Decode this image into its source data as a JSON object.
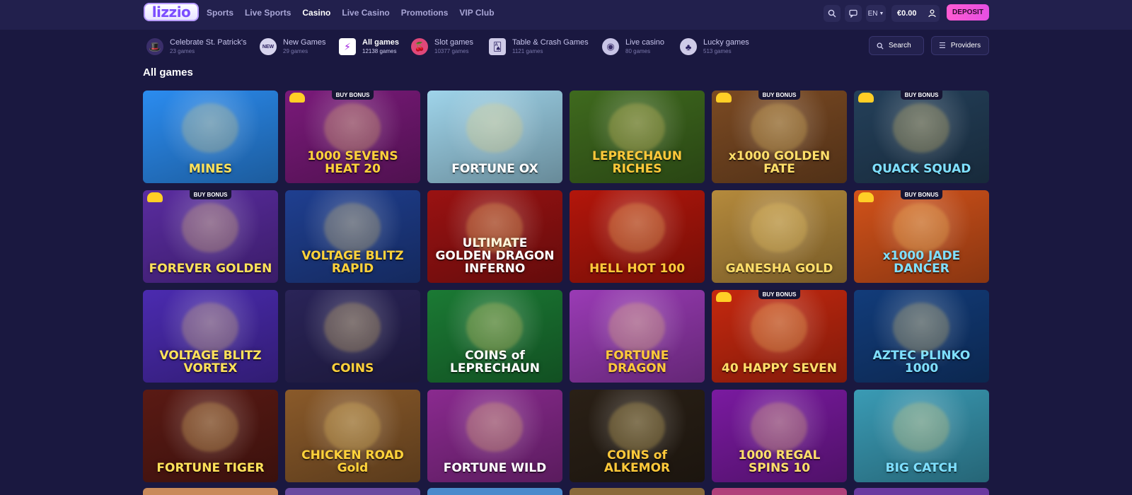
{
  "brand": {
    "logo": "lizzio"
  },
  "nav": {
    "items": [
      {
        "label": "Sports",
        "active": false
      },
      {
        "label": "Live Sports",
        "active": false
      },
      {
        "label": "Casino",
        "active": true
      },
      {
        "label": "Live Casino",
        "active": false
      },
      {
        "label": "Promotions",
        "active": false
      },
      {
        "label": "VIP Club",
        "active": false
      }
    ]
  },
  "topbar": {
    "search_icon": "search-icon",
    "chat_icon": "chat-icon",
    "language": "EN",
    "balance": "€0.00",
    "user_icon": "user-icon",
    "deposit_label": "DEPOSIT",
    "accent": "#ff5bd2"
  },
  "categories": [
    {
      "name": "Celebrate St. Patrick's",
      "count": "23 games",
      "icon": "hat-icon",
      "active": false
    },
    {
      "name": "New Games",
      "count": "29 games",
      "icon": "new-icon",
      "active": false
    },
    {
      "name": "All games",
      "count": "12138 games",
      "icon": "all-games-icon",
      "active": true
    },
    {
      "name": "Slot games",
      "count": "10377 games",
      "icon": "slot-icon",
      "active": false
    },
    {
      "name": "Table & Crash Games",
      "count": "1121 games",
      "icon": "cards-icon",
      "active": false
    },
    {
      "name": "Live casino",
      "count": "80 games",
      "icon": "chip-icon",
      "active": false
    },
    {
      "name": "Lucky games",
      "count": "513 games",
      "icon": "clover-icon",
      "active": false
    }
  ],
  "search_label": "Search",
  "providers_label": "Providers",
  "page_title": "All games",
  "games": [
    {
      "title": "MINES",
      "badge": "",
      "bg": "#2b8cf0"
    },
    {
      "title": "1000 SEVENS HEAT 20",
      "badge": "BUY BONUS",
      "bg": "#7a1a7a"
    },
    {
      "title": "FORTUNE OX",
      "badge": "",
      "bg": "#9fd4ea"
    },
    {
      "title": "LEPRECHAUN RICHES",
      "badge": "",
      "bg": "#3f6a1e"
    },
    {
      "title": "x1000 GOLDEN FATE",
      "badge": "BUY BONUS",
      "bg": "#7b4a23"
    },
    {
      "title": "QUACK SQUAD",
      "badge": "BUY BONUS",
      "bg": "#24405a"
    },
    {
      "title": "FOREVER GOLDEN",
      "badge": "BUY BONUS",
      "bg": "#5a2ca0"
    },
    {
      "title": "VOLTAGE BLITZ RAPID",
      "badge": "",
      "bg": "#1f3f90"
    },
    {
      "title": "ULTIMATE GOLDEN DRAGON INFERNO",
      "badge": "",
      "bg": "#9a1212"
    },
    {
      "title": "HELL HOT 100",
      "badge": "",
      "bg": "#b3160b"
    },
    {
      "title": "GANESHA GOLD",
      "badge": "",
      "bg": "#b58a3c"
    },
    {
      "title": "x1000 JADE DANCER",
      "badge": "BUY BONUS",
      "bg": "#d2521a"
    },
    {
      "title": "VOLTAGE BLITZ VORTEX",
      "badge": "",
      "bg": "#4b2bb0"
    },
    {
      "title": "COINS",
      "badge": "",
      "bg": "#2a2458"
    },
    {
      "title": "COINS of LEPRECHAUN",
      "badge": "",
      "bg": "#1b7a34"
    },
    {
      "title": "FORTUNE DRAGON",
      "badge": "",
      "bg": "#9a3bb5"
    },
    {
      "title": "40 HAPPY SEVEN",
      "badge": "BUY BONUS",
      "bg": "#c5280f"
    },
    {
      "title": "AZTEC PLINKO 1000",
      "badge": "",
      "bg": "#123c7a"
    },
    {
      "title": "FORTUNE TIGER",
      "badge": "",
      "bg": "#5a1a14"
    },
    {
      "title": "CHICKEN ROAD Gold",
      "badge": "",
      "bg": "#8a5a2a"
    },
    {
      "title": "FORTUNE WILD",
      "badge": "",
      "bg": "#8a2a8f"
    },
    {
      "title": "COINS of ALKEMOR",
      "badge": "",
      "bg": "#2a2016"
    },
    {
      "title": "1000 REGAL SPINS 10",
      "badge": "",
      "bg": "#7a1aa0"
    },
    {
      "title": "BIG CATCH",
      "badge": "",
      "bg": "#3a9bb5"
    }
  ]
}
